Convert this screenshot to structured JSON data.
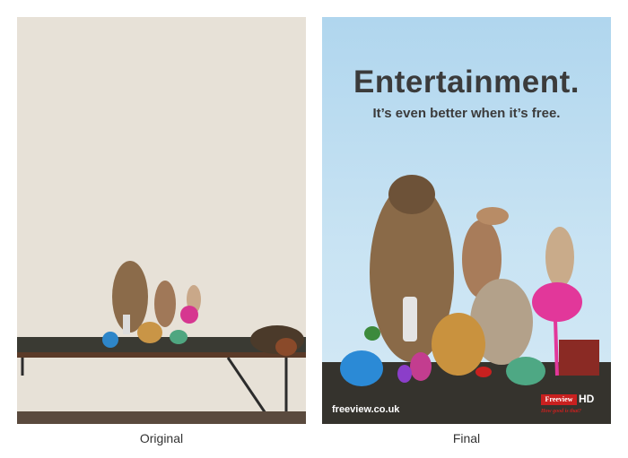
{
  "captions": {
    "original": "Original",
    "final": "Final"
  },
  "poster": {
    "headline": "Entertainment.",
    "subline": "It’s even better when it’s free.",
    "url": "freeview.co.uk",
    "logo_brand": "Freeview",
    "logo_hd": "HD",
    "tagline": "How good is that?"
  },
  "colors": {
    "left_wall": "#e7e1d7",
    "sky": "#b8dbf0",
    "table": "#3d3b34",
    "logo_red": "#c8201f"
  }
}
